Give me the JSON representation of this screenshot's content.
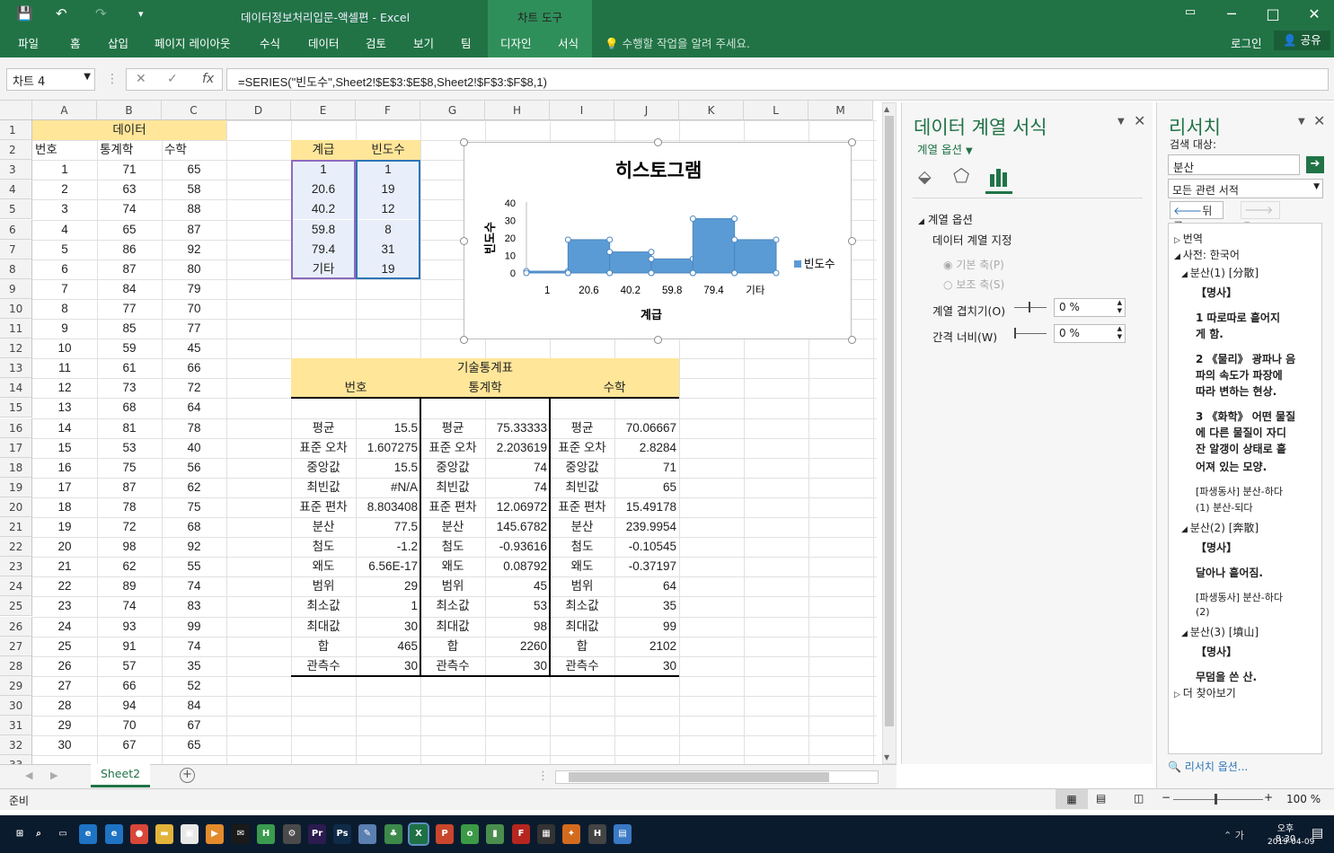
{
  "titlebar": {
    "title": "데이터정보처리입문-액셀편 - Excel",
    "chart_tools": "차트 도구",
    "login": "로그인",
    "share": "공유"
  },
  "ribbon": {
    "tabs": [
      "파일",
      "홈",
      "삽입",
      "페이지 레이아웃",
      "수식",
      "데이터",
      "검토",
      "보기",
      "팀"
    ],
    "chart_tabs": [
      "디자인",
      "서식"
    ],
    "tell_me": "수행할 작업을 알려 주세요."
  },
  "formula_bar": {
    "name_box": "차트 4",
    "formula": "=SERIES(\"빈도수\",Sheet2!$E$3:$E$8,Sheet2!$F$3:$F$8,1)"
  },
  "columns": [
    "A",
    "B",
    "C",
    "D",
    "E",
    "F",
    "G",
    "H",
    "I",
    "J",
    "K",
    "L",
    "M"
  ],
  "rows": [
    "1",
    "2",
    "3",
    "4",
    "5",
    "6",
    "7",
    "8",
    "9",
    "10",
    "11",
    "12",
    "13",
    "14",
    "15",
    "16",
    "17",
    "18",
    "19",
    "20",
    "21",
    "22",
    "23",
    "24",
    "25",
    "26",
    "27",
    "28",
    "29",
    "30",
    "31",
    "32",
    "33"
  ],
  "data_header": "데이터",
  "data_cols": [
    "번호",
    "통계학",
    "수학"
  ],
  "data": [
    [
      1,
      71,
      65
    ],
    [
      2,
      63,
      58
    ],
    [
      3,
      74,
      88
    ],
    [
      4,
      65,
      87
    ],
    [
      5,
      86,
      92
    ],
    [
      6,
      87,
      80
    ],
    [
      7,
      84,
      79
    ],
    [
      8,
      77,
      70
    ],
    [
      9,
      85,
      77
    ],
    [
      10,
      59,
      45
    ],
    [
      11,
      61,
      66
    ],
    [
      12,
      73,
      72
    ],
    [
      13,
      68,
      64
    ],
    [
      14,
      81,
      78
    ],
    [
      15,
      53,
      40
    ],
    [
      16,
      75,
      56
    ],
    [
      17,
      87,
      62
    ],
    [
      18,
      78,
      75
    ],
    [
      19,
      72,
      68
    ],
    [
      20,
      98,
      92
    ],
    [
      21,
      62,
      55
    ],
    [
      22,
      89,
      74
    ],
    [
      23,
      74,
      83
    ],
    [
      24,
      93,
      99
    ],
    [
      25,
      91,
      74
    ],
    [
      26,
      57,
      35
    ],
    [
      27,
      66,
      52
    ],
    [
      28,
      94,
      84
    ],
    [
      29,
      70,
      67
    ],
    [
      30,
      67,
      65
    ]
  ],
  "freq_table": {
    "headers": [
      "계급",
      "빈도수"
    ],
    "rows": [
      [
        "1",
        "1"
      ],
      [
        "20.6",
        "19"
      ],
      [
        "40.2",
        "12"
      ],
      [
        "59.8",
        "8"
      ],
      [
        "79.4",
        "31"
      ],
      [
        "기타",
        "19"
      ]
    ]
  },
  "stats": {
    "title": "기술통계표",
    "groups": [
      "번호",
      "통계학",
      "수학"
    ],
    "labels": [
      "평균",
      "표준 오차",
      "중앙값",
      "최빈값",
      "표준 편차",
      "분산",
      "첨도",
      "왜도",
      "범위",
      "최소값",
      "최대값",
      "합",
      "관측수"
    ],
    "values": [
      [
        "15.5",
        "75.33333",
        "70.06667"
      ],
      [
        "1.607275",
        "2.203619",
        "2.8284"
      ],
      [
        "15.5",
        "74",
        "71"
      ],
      [
        "#N/A",
        "74",
        "65"
      ],
      [
        "8.803408",
        "12.06972",
        "15.49178"
      ],
      [
        "77.5",
        "145.6782",
        "239.9954"
      ],
      [
        "-1.2",
        "-0.93616",
        "-0.10545"
      ],
      [
        "6.56E-17",
        "0.08792",
        "-0.37197"
      ],
      [
        "29",
        "45",
        "64"
      ],
      [
        "1",
        "53",
        "35"
      ],
      [
        "30",
        "98",
        "99"
      ],
      [
        "465",
        "2260",
        "2102"
      ],
      [
        "30",
        "30",
        "30"
      ]
    ]
  },
  "chart_data": {
    "type": "bar",
    "title": "히스토그램",
    "xlabel": "계급",
    "ylabel": "빈도수",
    "categories": [
      "1",
      "20.6",
      "40.2",
      "59.8",
      "79.4",
      "기타"
    ],
    "series": [
      {
        "name": "빈도수",
        "values": [
          1,
          19,
          12,
          8,
          31,
          19
        ],
        "color": "#5b9bd5"
      }
    ],
    "ylim": [
      0,
      40
    ],
    "yticks": [
      "0",
      "10",
      "20",
      "30",
      "40"
    ],
    "legend": "right"
  },
  "format_pane": {
    "title": "데이터 계열 서식",
    "options_label": "계열 옵션",
    "section": "계열 옵션",
    "assign_label": "데이터 계열 지정",
    "primary_axis": "기본 축(P)",
    "secondary_axis": "보조 축(S)",
    "overlap_label": "계열 겹치기(O)",
    "overlap_value": "0 %",
    "gap_label": "간격 너비(W)",
    "gap_value": "0 %"
  },
  "research_pane": {
    "title": "리서치",
    "search_label": "검색 대상:",
    "search_value": "분산",
    "source": "모든 관련 서적",
    "back": "뒤로",
    "results": [
      "번역",
      "사전: 한국어",
      "분산(1) [分散]",
      "【명사】",
      "1 따로따로 흩어지",
      "게 함.",
      "2 《물리》 광파나 음",
      "파의 속도가 파장에",
      "따라 변하는 현상.",
      "3 《화학》 어떤 물질",
      "에 다른 물질이 자디",
      "잔 알갱이 상태로 흩",
      "어져 있는 모양.",
      "[파생동사] 분산-하다",
      "(1) 분산-되다",
      "분산(2) [奔散]",
      "【명사】",
      "달아나 흩어짐.",
      "[파생동사] 분산-하다",
      "(2)",
      "분산(3) [墳山]",
      "【명사】",
      "무덤을 쓴 산.",
      "더 찾아보기"
    ],
    "options_link": "리서치 옵션..."
  },
  "sheet_tab": "Sheet2",
  "status": {
    "ready": "준비",
    "zoom": "100 %"
  },
  "clock": {
    "time": "오후 8:30",
    "date": "2019-04-09"
  }
}
